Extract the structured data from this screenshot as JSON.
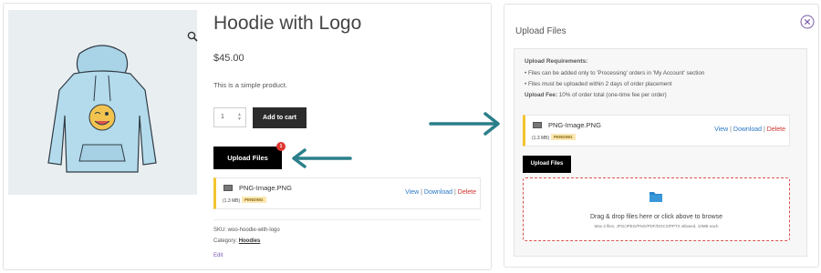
{
  "product": {
    "title": "Hoodie with Logo",
    "price": "$45.00",
    "description": "This is a simple product.",
    "quantity": "1",
    "add_to_cart_label": "Add to cart",
    "upload_files_label": "Upload Files",
    "badge_count": "1",
    "sku_text": "SKU: woo-hoodie-with-logo",
    "category_prefix": "Category: ",
    "category_link": "Hoodies",
    "edit_label": "Edit"
  },
  "file": {
    "name": "PNG-Image.PNG",
    "size": "(1.3 MB)",
    "status": "PENDING",
    "view_label": "View",
    "download_label": "Download",
    "delete_label": "Delete",
    "sep": "|"
  },
  "modal": {
    "title": "Upload Files",
    "requirements_heading": "Upload Requirements:",
    "requirement_1": "• Files can be added only to 'Processing' orders in 'My Account' section",
    "requirement_2": "• Files must be uploaded within 2 days of order placement",
    "fee_label": "Upload Fee:",
    "fee_value": " 10% of order total (one-time fee per order)",
    "upload_button_label": "Upload Files",
    "dropzone_text": "Drag & drop files here or click above to browse",
    "dropzone_subtext": "Max 3 files, JPG/JPEG/PNG/PDF/DOCX/PPTX allowed, 10MB each"
  },
  "colors": {
    "accent_yellow": "#f4c430",
    "arrow_teal": "#2a7f8a",
    "delete_red": "#d0312d",
    "link_blue": "#2a76c6",
    "badge_red": "#e0352f"
  },
  "icons": [
    "zoom-icon",
    "image-thumb-icon",
    "close-icon",
    "folder-icon",
    "arrow-right-icon",
    "arrow-left-icon"
  ]
}
